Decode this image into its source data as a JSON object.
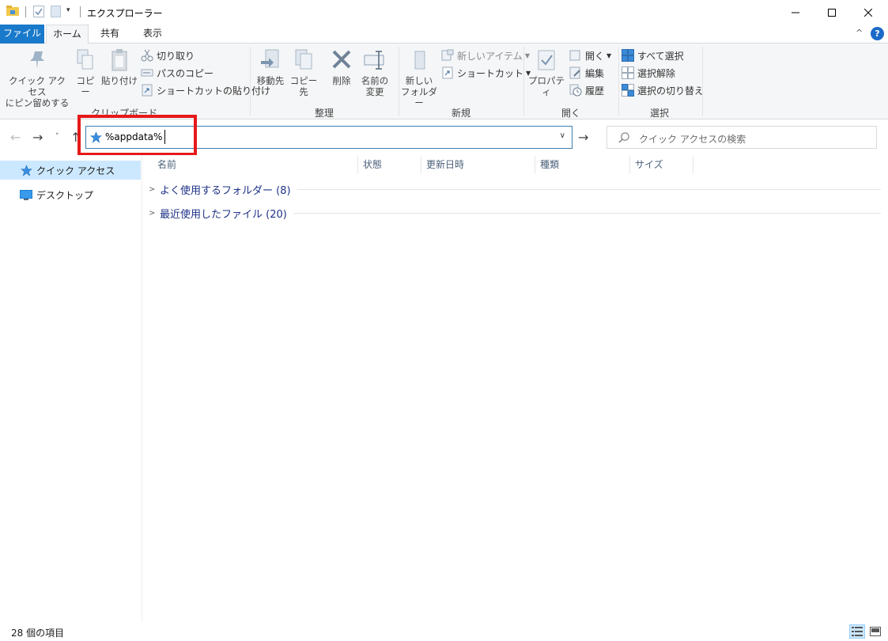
{
  "window": {
    "title": "エクスプローラー",
    "minimize_icon": "minimize-icon",
    "maximize_icon": "maximize-icon",
    "close_icon": "close-icon"
  },
  "quick_access_toolbar": {
    "dropdown_glyph": "▾"
  },
  "ribbon_tabs": {
    "file": "ファイル",
    "home": "ホーム",
    "share": "共有",
    "view": "表示",
    "collapse_glyph": "^",
    "help_glyph": "?"
  },
  "ribbon": {
    "clipboard": {
      "label": "クリップボード",
      "pin_line1": "クイック アクセス",
      "pin_line2": "にピン留めする",
      "copy": "コピー",
      "paste": "貼り付け",
      "cut": "切り取り",
      "copy_path": "パスのコピー",
      "paste_shortcut": "ショートカットの貼り付け"
    },
    "organize": {
      "label": "整理",
      "move_to": "移動先",
      "copy_to": "コピー先",
      "delete": "削除",
      "rename_line1": "名前の",
      "rename_line2": "変更"
    },
    "new": {
      "label": "新規",
      "new_folder_line1": "新しい",
      "new_folder_line2": "フォルダー",
      "new_item": "新しいアイテム",
      "shortcut": "ショートカット"
    },
    "open": {
      "label": "開く",
      "properties": "プロパティ",
      "open": "開く",
      "edit": "編集",
      "history": "履歴"
    },
    "select": {
      "label": "選択",
      "select_all": "すべて選択",
      "select_none": "選択解除",
      "invert": "選択の切り替え"
    }
  },
  "navigation": {
    "back_glyph": "←",
    "forward_glyph": "→",
    "recent_glyph": "˅",
    "up_glyph": "↑",
    "address_value": "%appdata%",
    "address_dropdown_glyph": "∨",
    "go_glyph": "→",
    "search_placeholder": "クイック アクセスの検索"
  },
  "nav_pane": {
    "items": [
      {
        "label": "クイック アクセス",
        "icon": "quick-access-star-icon",
        "selected": true
      },
      {
        "label": "デスクトップ",
        "icon": "desktop-icon",
        "selected": false
      }
    ]
  },
  "columns": {
    "name": "名前",
    "status": "状態",
    "date_modified": "更新日時",
    "type": "種類",
    "size": "サイズ"
  },
  "groups": [
    {
      "title": "よく使用するフォルダー (8)"
    },
    {
      "title": "最近使用したファイル (20)"
    }
  ],
  "status_bar": {
    "item_count": "28 個の項目"
  },
  "colors": {
    "accent": "#1979ca",
    "selection": "#cce8ff",
    "highlight_box": "#e61919",
    "help": "#1b6ac9"
  }
}
